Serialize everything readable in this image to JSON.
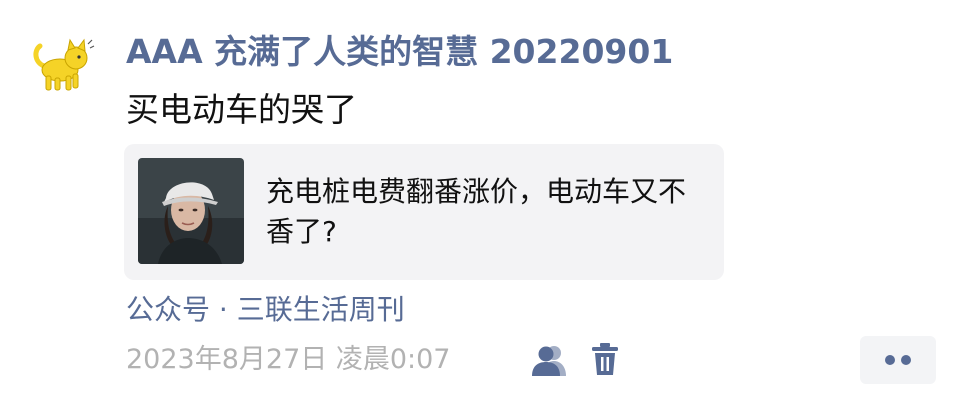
{
  "post": {
    "author": "AAA 充满了人类的智慧 20220901",
    "text": "买电动车的哭了",
    "share_card": {
      "title": "充电桩电费翻番涨价，电动车又不香了?"
    },
    "source": "公众号 · 三联生活周刊",
    "timestamp": "2023年8月27日 凌晨0:07"
  },
  "icons": {
    "avatar": "yellow-cat-avatar",
    "visibility": "people-icon",
    "delete": "trash-icon",
    "more": "more-dots-icon"
  },
  "colors": {
    "link": "#576b95",
    "text": "#111111",
    "muted": "#b2b2b2",
    "card_bg": "#f3f3f5",
    "avatar_yellow": "#f5d327"
  }
}
